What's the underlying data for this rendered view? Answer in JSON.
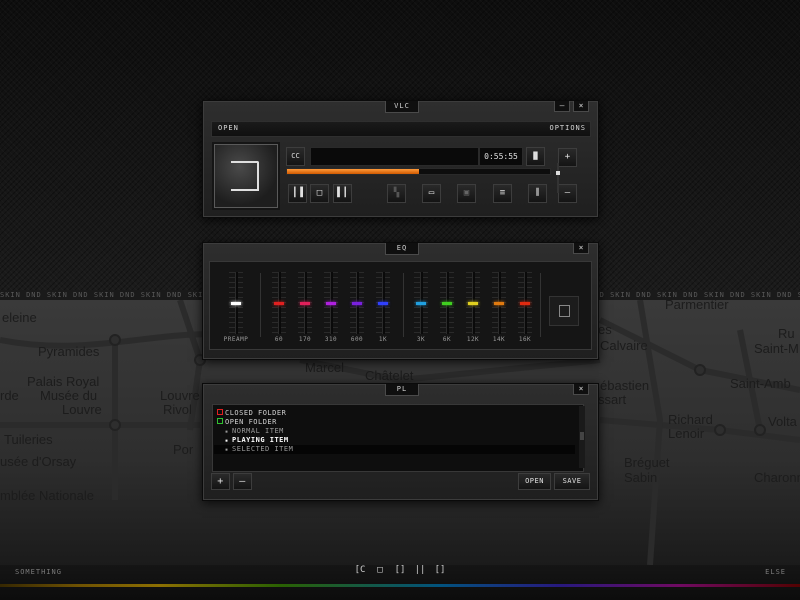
{
  "background": {
    "marquee_text": "SKIN DND SKIN DND SKIN DND SKIN DND SKIN DND SKIN DND SKIN DND SKIN DND SKIN DND SKIN DND SKIN DND SKIN DND SKIN DND SKIN DND SKIN DND SKIN DND SKIN DND SKIN DND SKIN DND SKIN DND SKIN DND SKIN DND",
    "map_labels": [
      "eleine",
      "Pyramides",
      "Palais Royal",
      "Musée du",
      "Louvre",
      "rde",
      "Tuileries",
      "usée d'Orsay",
      "mblée Nationale",
      "Louvre",
      "Rivol",
      "Por",
      "Marcel",
      "Châtelet",
      "Parmentier",
      "es",
      "Calvaire",
      "ébastien",
      "ssart",
      "Richard",
      "Lenoir",
      "Bréguet",
      "Sabin",
      "Ru",
      "Saint-M",
      "Saint-Amb",
      "Volta",
      "Charonne"
    ]
  },
  "bottom": {
    "left_text": "SOMETHING",
    "right_text": "ELSE",
    "controls": [
      "[C",
      "□",
      "[]",
      "||",
      "[]"
    ]
  },
  "main_window": {
    "title": "VLC",
    "minimize_label": "–",
    "close_label": "×",
    "open_label": "OPEN",
    "options_label": "OPTIONS",
    "cc_label": "CC",
    "time": "0:55:55",
    "next_chapter_label": "▐▌",
    "volume_up_label": "+",
    "volume_down_label": "–",
    "progress_fraction": 0.5,
    "buttons": {
      "prev": "┃▐",
      "stop": "□",
      "next": "▌┃",
      "playlist": "≡",
      "equalizer": "░"
    }
  },
  "eq_window": {
    "title": "EQ",
    "close_label": "×",
    "bands": [
      {
        "label": "PREAMP",
        "color": "#ffffff",
        "level": 0.5
      },
      {
        "label": "60",
        "color": "#e02020",
        "level": 0.5
      },
      {
        "label": "170",
        "color": "#e0205a",
        "level": 0.5
      },
      {
        "label": "310",
        "color": "#b020e0",
        "level": 0.5
      },
      {
        "label": "600",
        "color": "#7a20e0",
        "level": 0.5
      },
      {
        "label": "1K",
        "color": "#3040ff",
        "level": 0.5
      },
      {
        "label": "3K",
        "color": "#20a0e0",
        "level": 0.5
      },
      {
        "label": "6K",
        "color": "#40d020",
        "level": 0.5
      },
      {
        "label": "12K",
        "color": "#e0d020",
        "level": 0.5
      },
      {
        "label": "14K",
        "color": "#e07a10",
        "level": 0.5
      },
      {
        "label": "16K",
        "color": "#e02a10",
        "level": 0.5
      }
    ]
  },
  "pl_window": {
    "title": "PL",
    "close_label": "×",
    "items": [
      {
        "text": "CLOSED FOLDER",
        "type": "folder",
        "color": "#e02020"
      },
      {
        "text": "OPEN FOLDER",
        "type": "folder",
        "color": "#30c030"
      },
      {
        "text": "NORMAL ITEM",
        "type": "item"
      },
      {
        "text": "PLAYING ITEM",
        "type": "item"
      },
      {
        "text": "SELECTED ITEM",
        "type": "item"
      }
    ],
    "add_label": "+",
    "remove_label": "–",
    "open_label": "OPEN",
    "save_label": "SAVE"
  }
}
